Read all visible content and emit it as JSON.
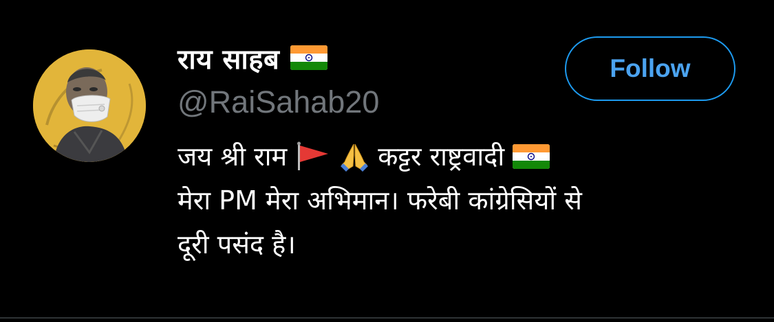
{
  "profile": {
    "display_name": "राय साहब",
    "name_flag_icon": "india-flag-icon",
    "handle": "@RaiSahab20"
  },
  "follow_button": {
    "label": "Follow",
    "border_color": "#1d9bf0",
    "text_color": "#4ba3f0"
  },
  "bio": {
    "line1": {
      "part1": "जय श्री राम",
      "part2": "कट्टर राष्ट्रवादी"
    },
    "line2": "मेरा PM मेरा अभिमान। फरेबी कांग्रेसियों से",
    "line3": "दूरी पसंद है।",
    "icons": [
      "triangular-flag-icon",
      "folded-hands-icon",
      "india-flag-icon"
    ]
  },
  "colors": {
    "background": "#000000",
    "primary_text": "#ffffff",
    "secondary_text": "#71767b",
    "avatar_bg": "#e2b53a"
  }
}
